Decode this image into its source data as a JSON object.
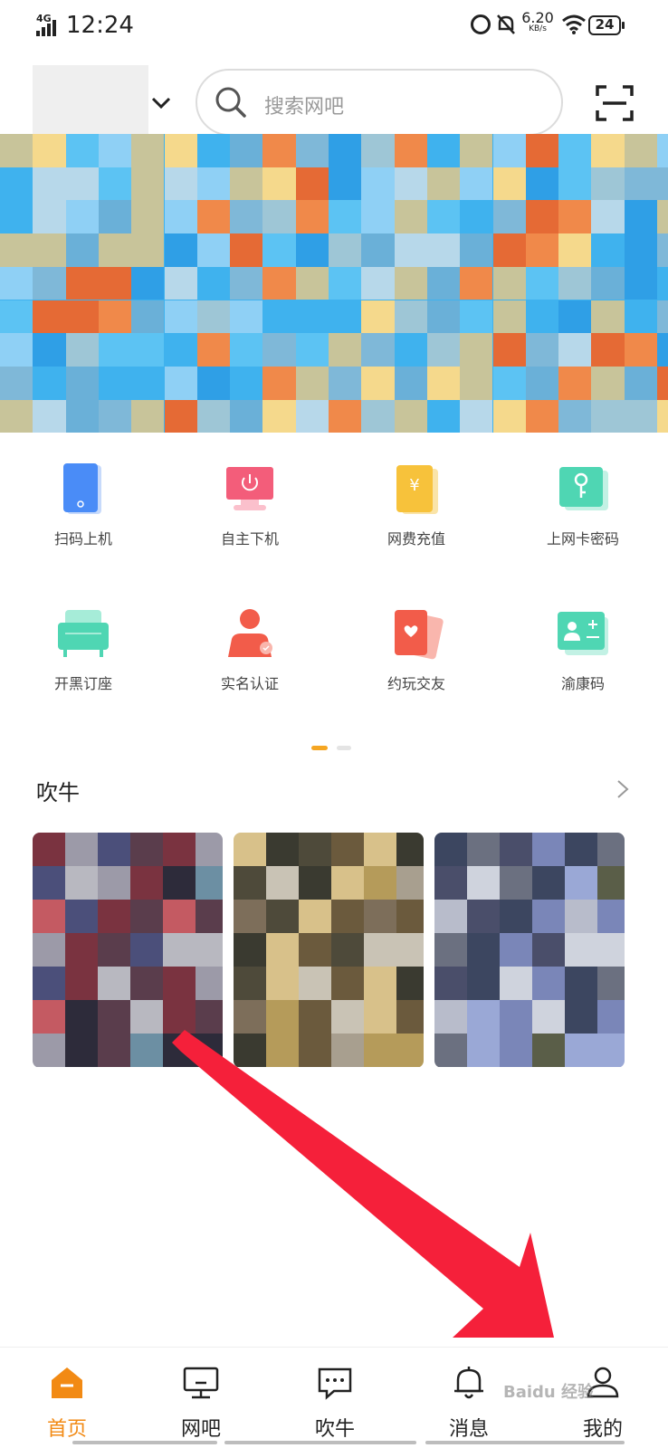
{
  "status_bar": {
    "network": "4G",
    "time": "12:24",
    "speed_value": "6.20",
    "speed_unit": "KB/s",
    "battery": "24"
  },
  "header": {
    "search_placeholder": "搜索网吧"
  },
  "quick_actions": [
    {
      "label": "扫码上机",
      "icon": "phone-icon",
      "color": "#4a8cf7"
    },
    {
      "label": "自主下机",
      "icon": "power-monitor-icon",
      "color": "#f35d7a"
    },
    {
      "label": "网费充值",
      "icon": "yen-card-icon",
      "color": "#f7c23b"
    },
    {
      "label": "上网卡密码",
      "icon": "key-icon",
      "color": "#4fd6b3"
    },
    {
      "label": "开黑订座",
      "icon": "sofa-icon",
      "color": "#4fd6b3"
    },
    {
      "label": "实名认证",
      "icon": "user-verify-icon",
      "color": "#f25c4a"
    },
    {
      "label": "约玩交友",
      "icon": "cards-icon",
      "color": "#f25c4a"
    },
    {
      "label": "渝康码",
      "icon": "id-card-icon",
      "color": "#4fd6b3"
    }
  ],
  "section": {
    "title": "吹牛"
  },
  "bottom_nav": [
    {
      "label": "首页",
      "icon": "home-icon",
      "active": true
    },
    {
      "label": "网吧",
      "icon": "monitor-icon",
      "active": false
    },
    {
      "label": "吹牛",
      "icon": "chat-icon",
      "active": false
    },
    {
      "label": "消息",
      "icon": "bell-icon",
      "active": false
    },
    {
      "label": "我的",
      "icon": "profile-icon",
      "active": false
    }
  ],
  "watermark": "Baidu 经验",
  "colors": {
    "accent": "#f28a14",
    "arrow": "#f5203a"
  }
}
